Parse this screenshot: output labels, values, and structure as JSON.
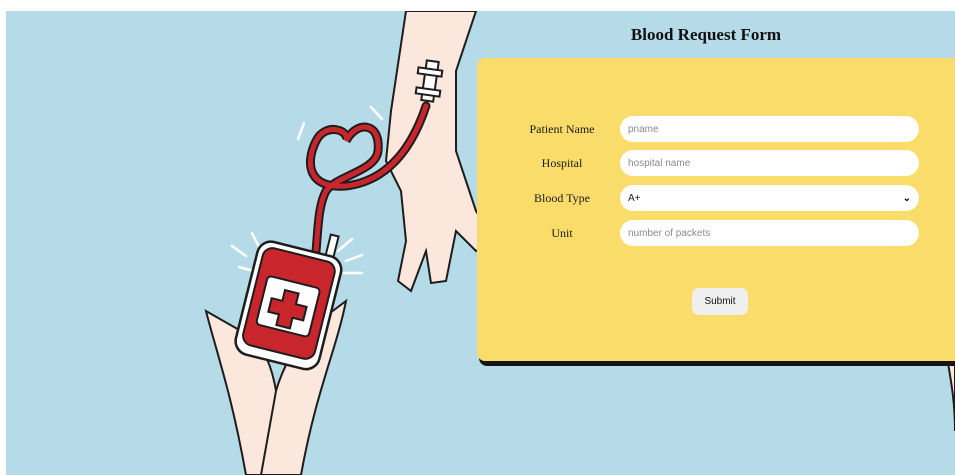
{
  "form": {
    "title": "Blood Request Form",
    "fields": [
      {
        "label": "Patient Name",
        "placeholder": "pname"
      },
      {
        "label": "Hospital",
        "placeholder": "hospital name"
      },
      {
        "label": "Blood Type",
        "value": "A+"
      },
      {
        "label": "Unit",
        "placeholder": "number of packets"
      }
    ],
    "submit_label": "Submit"
  },
  "colors": {
    "background": "#b5dbe8",
    "card": "#f9dc6a",
    "blood": "#c9252c"
  }
}
